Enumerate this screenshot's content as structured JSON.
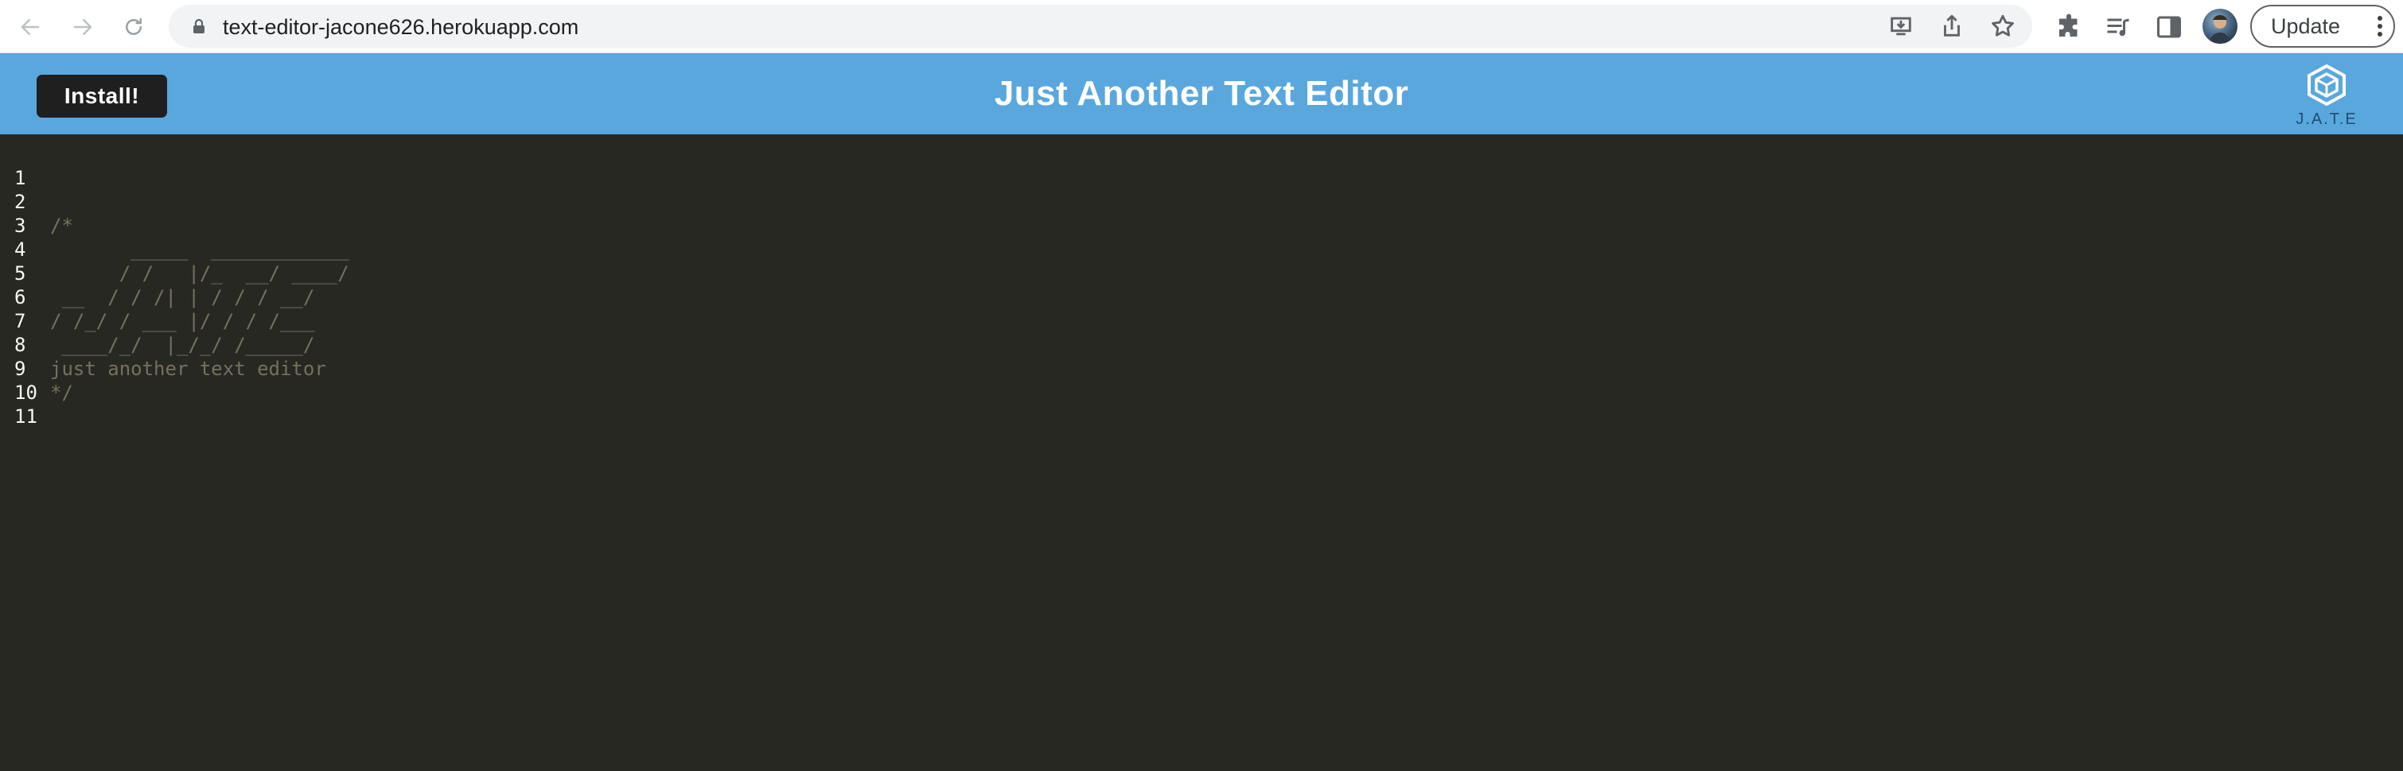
{
  "browser": {
    "url": "text-editor-jacone626.herokuapp.com",
    "update_label": "Update",
    "icons": {
      "back": "arrow-left-icon",
      "forward": "arrow-right-icon",
      "reload": "reload-icon",
      "lock": "lock-icon",
      "install_app": "install-app-icon",
      "share": "share-icon",
      "bookmark": "star-icon",
      "extensions": "puzzle-icon",
      "reading_list": "media-list-icon",
      "side_panel": "side-panel-icon",
      "profile": "avatar",
      "menu": "kebab-menu-icon"
    }
  },
  "header": {
    "install_label": "Install!",
    "title": "Just Another Text Editor",
    "logo_text": "J.A.T.E",
    "background_color": "#5aa7de"
  },
  "editor": {
    "background_color": "#272822",
    "comment_color": "#75715e",
    "lines": [
      {
        "number": "1",
        "text": ""
      },
      {
        "number": "2",
        "text": "/*"
      },
      {
        "number": "3",
        "text": "       _____  ____________"
      },
      {
        "number": "4",
        "text": "      / /   |/_  __/ ____/"
      },
      {
        "number": "5",
        "text": " __  / / /| | / / / __/"
      },
      {
        "number": "6",
        "text": "/ /_/ / ___ |/ / / /___"
      },
      {
        "number": "7",
        "text": " ____/_/  |_/_/ /_____/"
      },
      {
        "number": "8",
        "text": "just another text editor"
      },
      {
        "number": "9",
        "text": "*/"
      },
      {
        "number": "10",
        "text": ""
      },
      {
        "number": "11",
        "text": ""
      }
    ]
  }
}
